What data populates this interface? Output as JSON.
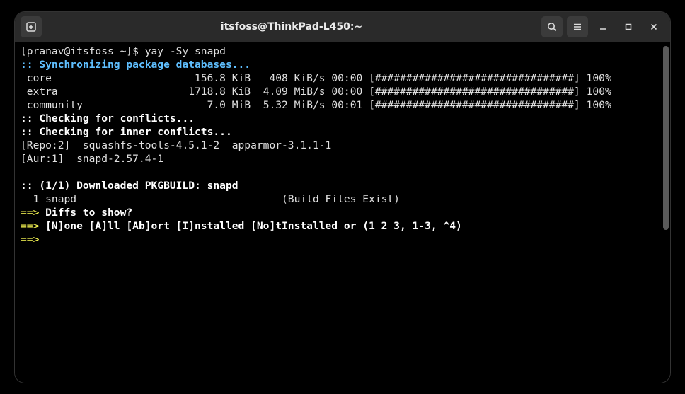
{
  "window": {
    "title": "itsfoss@ThinkPad-L450:~"
  },
  "term": {
    "prompt": "[pranav@itsfoss ~]$ ",
    "cmd": "yay -Sy snapd",
    "sync": ":: Synchronizing package databases...",
    "core_name": " core",
    "core_size": "156.8 KiB",
    "core_rate": "408 KiB/s",
    "core_time": "00:00",
    "core_bar": "[################################]",
    "core_pct": "100%",
    "extra_name": " extra",
    "extra_size": "1718.8 KiB",
    "extra_rate": "4.09 MiB/s",
    "extra_time": "00:00",
    "extra_bar": "[################################]",
    "extra_pct": "100%",
    "comm_name": " community",
    "comm_size": "7.0 MiB",
    "comm_rate": "5.32 MiB/s",
    "comm_time": "00:01",
    "comm_bar": "[################################]",
    "comm_pct": "100%",
    "check_conflicts": ":: Checking for conflicts...",
    "check_inner": ":: Checking for inner conflicts...",
    "repo_line": "[Repo:2]  squashfs-tools-4.5.1-2  apparmor-3.1.1-1",
    "aur_line": "[Aur:1]  snapd-2.57.4-1",
    "blank": "",
    "pkgbuild": ":: (1/1) Downloaded PKGBUILD: snapd",
    "snapd_item": "  1 snapd                                ",
    "build_exist": " (Build Files Exist)",
    "arrow": "==>",
    "diffs": " Diffs to show?",
    "options": " [N]one [A]ll [Ab]ort [I]nstalled [No]tInstalled or (1 2 3, 1-3, ^4)",
    "empty_arrow": "==>"
  }
}
